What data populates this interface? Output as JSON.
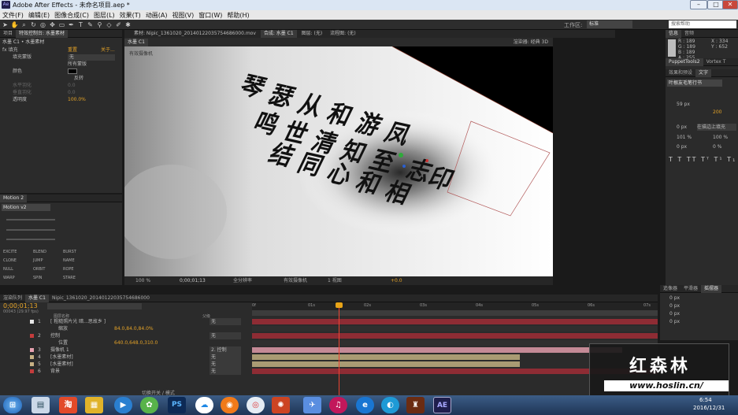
{
  "title": "Adobe After Effects - 未命名项目.aep *",
  "menu": [
    "文件(F)",
    "编辑(E)",
    "图像合成(C)",
    "图层(L)",
    "效果(T)",
    "动画(A)",
    "视图(V)",
    "窗口(W)",
    "帮助(H)"
  ],
  "workspace": {
    "label": "工作区:",
    "value": "标准",
    "search": "搜索帮助"
  },
  "left_panel": {
    "tab1": "项目",
    "tab2": "特效控制台: 水墨素材",
    "comp_label": "水墨 C1 • 水墨素材",
    "fx_name": "fx 填充",
    "mask_label": "填充蒙版",
    "mask_val": "无",
    "all_masks": "所有蒙版",
    "reset": "重置",
    "about": "关于...",
    "color_label": "颜色",
    "invert_label": "反转",
    "hfeather": "水平羽化",
    "vfeather": "垂直羽化",
    "hv": "0.0",
    "vv": "0.0",
    "opacity_label": "透明度",
    "opacity_val": "100.0%"
  },
  "motion": {
    "tab": "Motion 2",
    "version": "Motion v2",
    "buttons": [
      "EXCITE",
      "BLEND",
      "BURST",
      "CLONE",
      "JUMP",
      "NAME",
      "NULL",
      "ORBIT",
      "ROPE",
      "WARP",
      "SPIN",
      "STARE"
    ]
  },
  "viewer": {
    "tab_footage": "素材: Nipic_1361020_20140122035754686000.mov",
    "tab_comp": "合成: 水墨 C1",
    "tab_layer": "图层: (无)",
    "tab_flow": "流程图: (无)",
    "sub_tab": "水墨 C1",
    "render_label": "渲染器: 经典 3D",
    "cam_label": "有效摄像机",
    "zoom": "100 %",
    "time": "0;00;01;13",
    "res": "全分辨率",
    "camera": "有效摄像机",
    "views": "1 视图",
    "offset": "+0.0"
  },
  "calligraphy": [
    "琴",
    "瑟",
    "从",
    "和",
    "游",
    "凤",
    "鸣",
    "世",
    "清",
    "知",
    "至",
    "志",
    "结",
    "同",
    "心",
    "和",
    "相",
    "印"
  ],
  "info": {
    "tab1": "信息",
    "tab2": "音频",
    "r": "R : 189",
    "g": "G : 189",
    "b": "B : 189",
    "a": "A : 255",
    "x": "X : 334",
    "y": "Y : 652"
  },
  "right": {
    "tab_puppet": "PuppetTools2",
    "tab_vortex": "Vortex T",
    "tab_fx": "效果和预设",
    "tab_text": "文字",
    "font": "叶根友毛笔行书",
    "size": "59 px",
    "tracking": "200",
    "px_val": "-",
    "tw": "0 px",
    "fill": "在描边上填充",
    "scale_v": "101 %",
    "scale_h": "100 %",
    "bl": "0 px",
    "ts": "0 %"
  },
  "right_bottom": {
    "tab1": "追像器",
    "tab2": "平滑器",
    "tab3": "摇摆器",
    "p1": "0 px",
    "p2": "0 px",
    "p3": "0 px",
    "p4": "0 px"
  },
  "timeline": {
    "tab_render": "渲染队列",
    "tab_comp": "水墨 C1",
    "tab_footage": "Nipic_1361020_20140122035754686000",
    "timecode": "0;00;01;13",
    "fps": "00043 (29.97 fps)",
    "search": "",
    "col_name": "图层名称",
    "col_parent": "父级",
    "toggle": "切换开关 / 模式",
    "ticks": [
      "0f",
      "01s",
      "02s",
      "03s",
      "04s",
      "05s",
      "06s",
      "07s"
    ],
    "layers": [
      {
        "num": "1",
        "name": "[ 粗糙照片光 暗...思故乡 ]",
        "parent": "无",
        "color": "#e8e8e8"
      },
      {
        "num": "",
        "name": "缩放",
        "parent": "",
        "color": "",
        "val": "84.0,84.0,84.0%"
      },
      {
        "num": "2",
        "name": "控制",
        "parent": "无",
        "color": "#c43c3c"
      },
      {
        "num": "",
        "name": "位置",
        "parent": "",
        "color": "",
        "val": "640.0,648.0,310.0"
      },
      {
        "num": "3",
        "name": "摄像机 1",
        "parent": "2. 控制",
        "color": "#e7a2b0"
      },
      {
        "num": "4",
        "name": "[水墨素材]",
        "parent": "无",
        "color": "#c7b184"
      },
      {
        "num": "5",
        "name": "[水墨素材]",
        "parent": "无",
        "color": "#c7b184"
      },
      {
        "num": "6",
        "name": "背景",
        "parent": "无",
        "color": "#c43c3c"
      }
    ]
  },
  "logo": {
    "text": "红森林",
    "url": "www.hoslin.cn/"
  },
  "taskbar": {
    "time": "6:54",
    "date": "2016/12/31",
    "items": [
      "淘",
      "PS",
      "AE"
    ]
  }
}
